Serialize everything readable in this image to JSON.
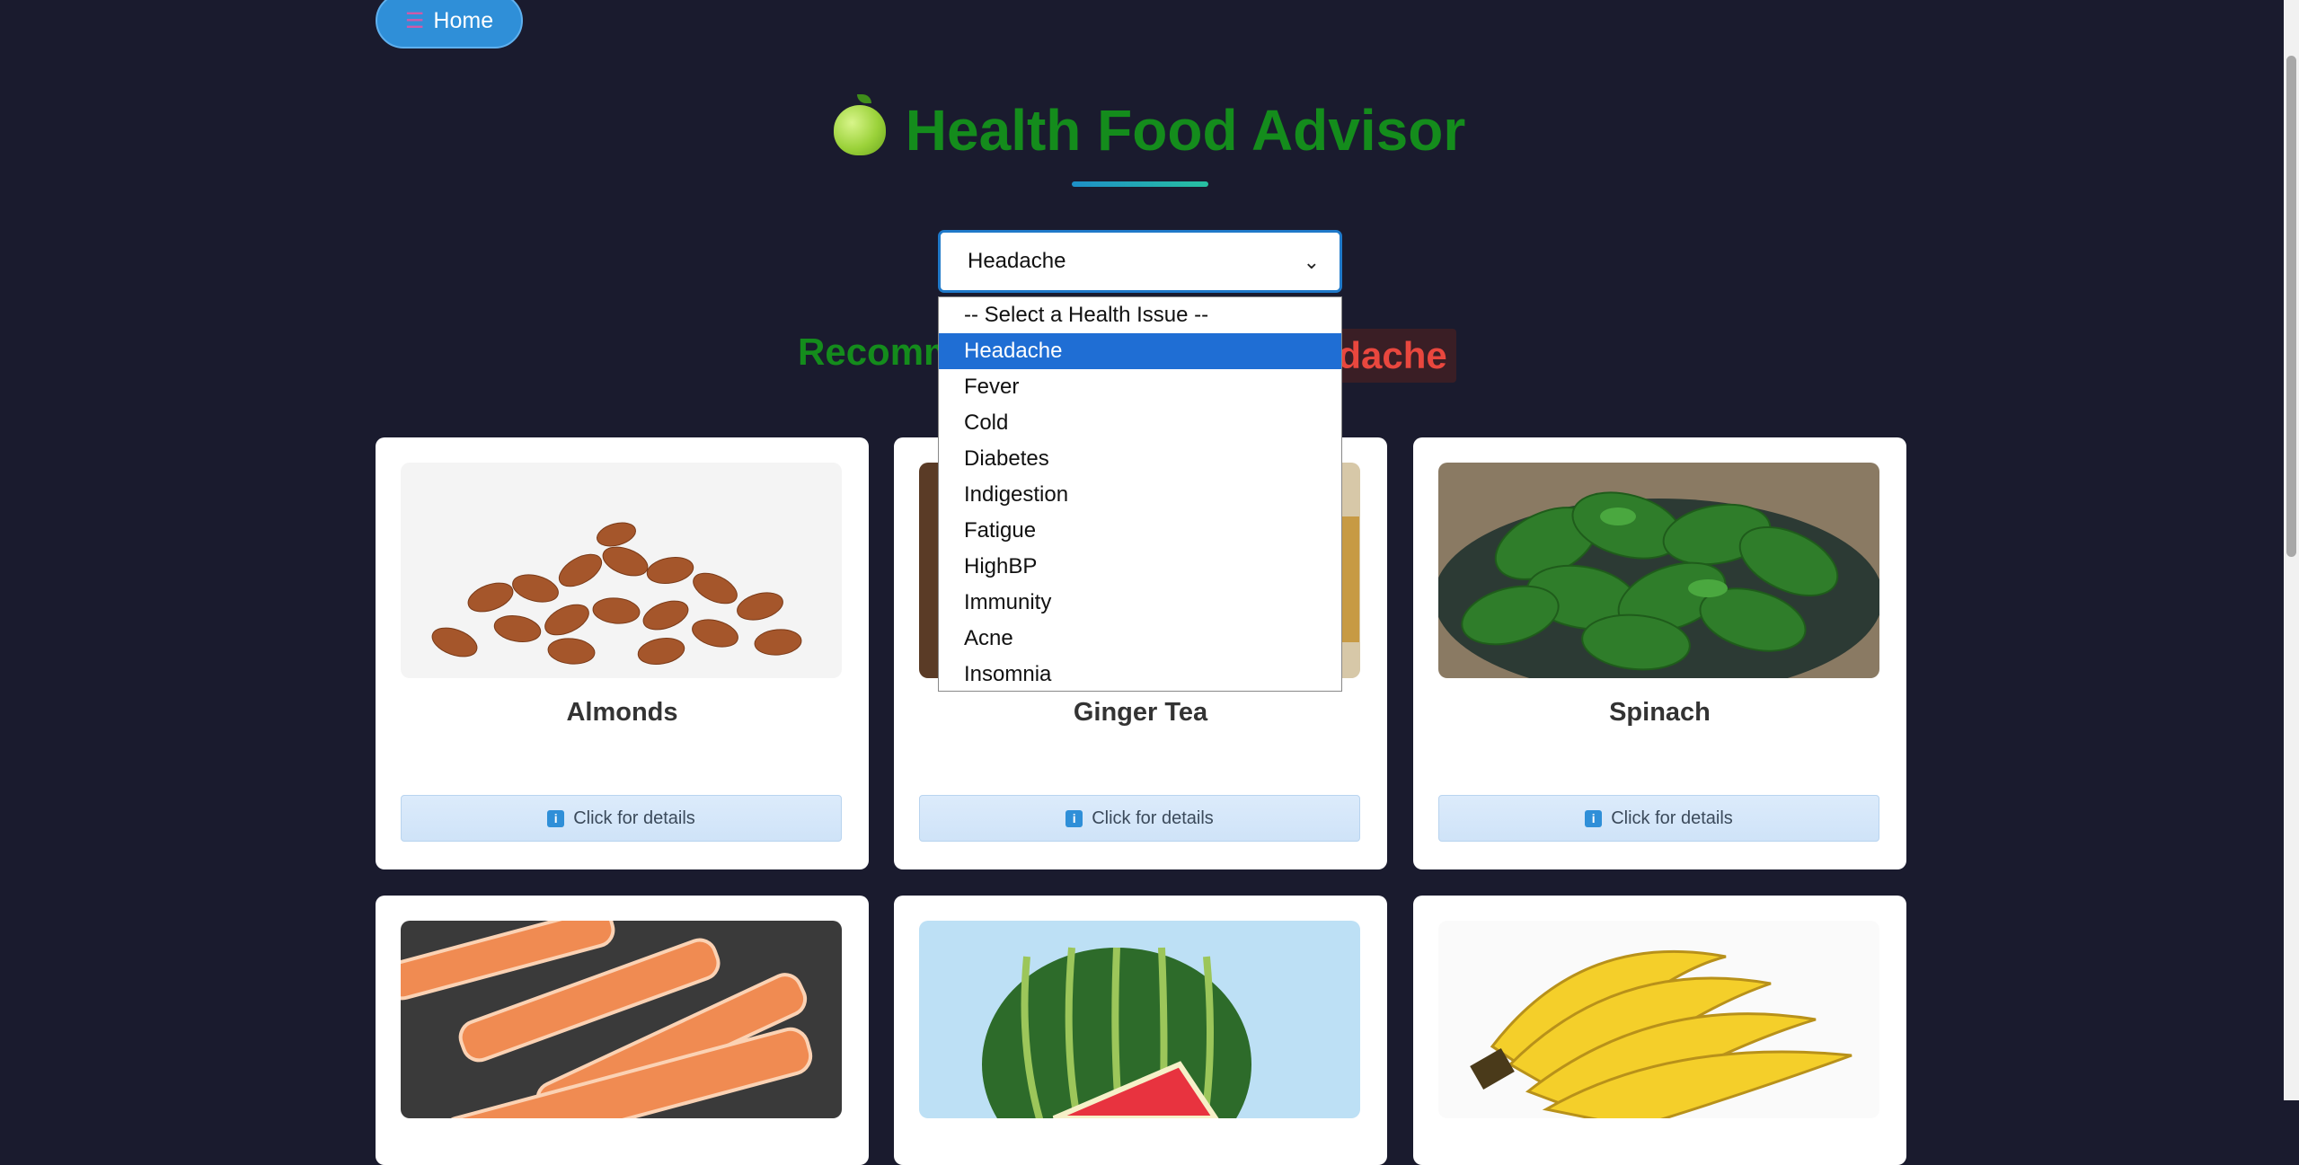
{
  "home": {
    "label": "Home",
    "icon": "home-icon"
  },
  "title": "Health Food Advisor",
  "select": {
    "value": "Headache",
    "options": [
      "-- Select a Health Issue --",
      "Headache",
      "Fever",
      "Cold",
      "Diabetes",
      "Indigestion",
      "Fatigue",
      "HighBP",
      "Immunity",
      "Acne",
      "Insomnia"
    ],
    "selected_index": 1
  },
  "recommend": {
    "prefix": "Recomm",
    "suffix": "adache"
  },
  "cards": [
    {
      "name": "Almonds",
      "button": "Click for details"
    },
    {
      "name": "Ginger Tea",
      "button": "Click for details"
    },
    {
      "name": "Spinach",
      "button": "Click for details"
    },
    {
      "name": "",
      "button": ""
    },
    {
      "name": "",
      "button": ""
    },
    {
      "name": "",
      "button": ""
    }
  ],
  "colors": {
    "background": "#1a1b2e",
    "title": "#148c1c",
    "accent": "#2f8fd8",
    "highlight": "#e9473e"
  }
}
